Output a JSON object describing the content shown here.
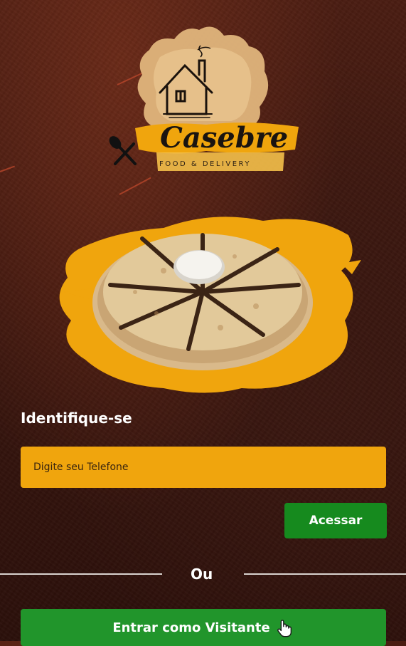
{
  "brand": {
    "name": "Casebre",
    "tagline": "FOOD & DELIVERY"
  },
  "login": {
    "heading": "Identifique-se",
    "phone_placeholder": "Digite seu Telefone",
    "access_label": "Acessar",
    "divider_label": "Ou",
    "guest_label": "Entrar como Visitante"
  },
  "icons": {
    "logo": "house-logo",
    "food": "quesadilla-plate-image",
    "pointer": "hand-pointer-icon"
  },
  "colors": {
    "accent": "#f0a50d",
    "primary_button": "#168a1e",
    "guest_button": "#21952b",
    "background": "#3a160e"
  }
}
